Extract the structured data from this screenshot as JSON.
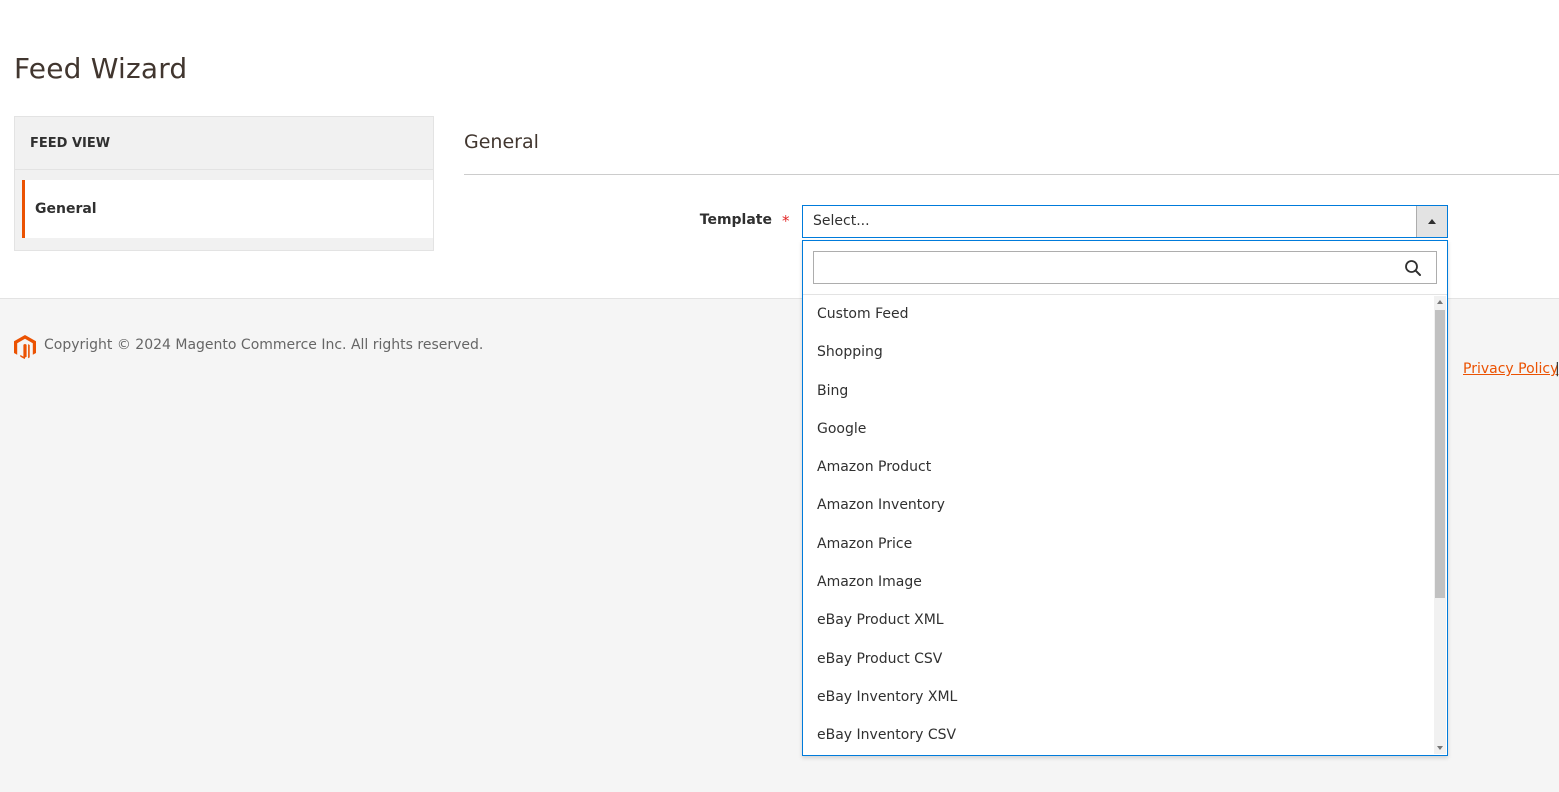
{
  "page": {
    "title": "Feed Wizard"
  },
  "sidebar": {
    "title": "FEED VIEW",
    "items": [
      {
        "label": "General",
        "active": true
      }
    ]
  },
  "main": {
    "section_title": "General",
    "fields": {
      "template": {
        "label": "Template",
        "required": "*",
        "value": "Select...",
        "search_placeholder": "",
        "options": [
          "Custom Feed",
          "Shopping",
          "Bing",
          "Google",
          "Amazon Product",
          "Amazon Inventory",
          "Amazon Price",
          "Amazon Image",
          "eBay Product XML",
          "eBay Product CSV",
          "eBay Inventory XML",
          "eBay Inventory CSV"
        ]
      }
    }
  },
  "footer": {
    "copyright": "Copyright © 2024 Magento Commerce Inc. All rights reserved.",
    "privacy_link": "Privacy Policy",
    "separator": "|"
  },
  "colors": {
    "accent": "#eb5202",
    "focus_border": "#007bdb",
    "required": "#e22626"
  },
  "icons": {
    "logo": "magento-logo-icon",
    "search": "search-icon",
    "dropdown_arrow": "chevron-up-icon"
  }
}
